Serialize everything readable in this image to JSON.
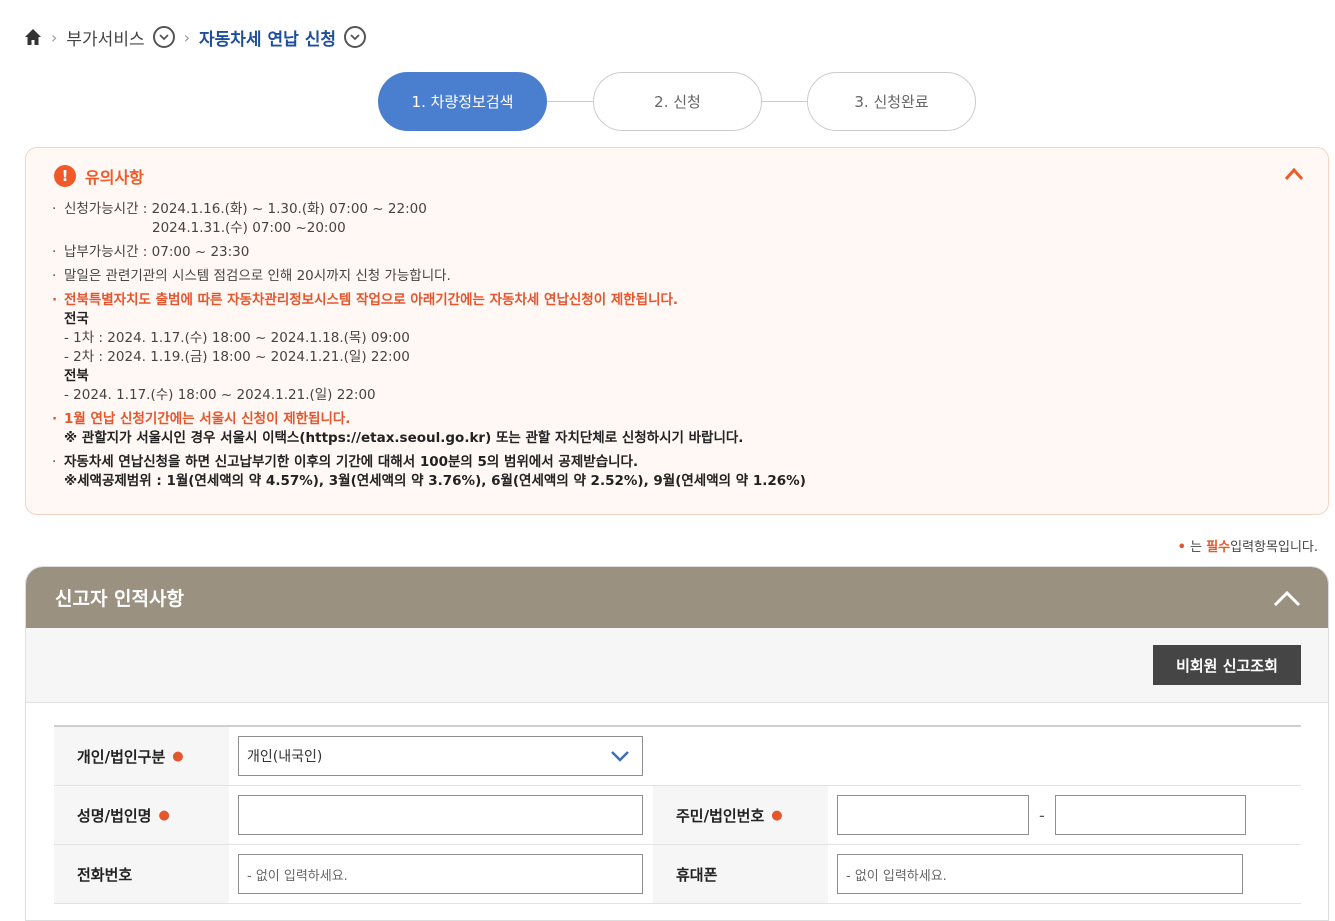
{
  "breadcrumb": {
    "home_icon": "home-icon",
    "item1": "부가서비스",
    "item2": "자동차세 연납 신청"
  },
  "steps": [
    {
      "label": "1. 차량정보검색",
      "active": true
    },
    {
      "label": "2. 신청",
      "active": false
    },
    {
      "label": "3. 신청완료",
      "active": false
    }
  ],
  "notice": {
    "title": "유의사항",
    "lines": {
      "l1": "신청가능시간 : 2024.1.16.(화) ~ 1.30.(화) 07:00 ~ 22:00",
      "l1b": "2024.1.31.(수) 07:00 ~20:00",
      "l2": "납부가능시간 : 07:00 ~ 23:30",
      "l3": "말일은 관련기관의 시스템 점검으로 인해 20시까지 신청 가능합니다.",
      "l4": "전북특별자치도 출범에 따른 자동차관리정보시스템 작업으로 아래기간에는 자동차세 연납신청이 제한됩니다.",
      "l4a": "전국",
      "l4b": "- 1차 : 2024. 1.17.(수) 18:00 ~ 2024.1.18.(목) 09:00",
      "l4c": "- 2차 : 2024. 1.19.(금) 18:00 ~ 2024.1.21.(일) 22:00",
      "l4d": "전북",
      "l4e": "- 2024. 1.17.(수) 18:00 ~ 2024.1.21.(일) 22:00",
      "l5": "1월 연납 신청기간에는 서울시 신청이 제한됩니다.",
      "l5b": "※ 관할지가 서울시인 경우 서울시 이택스(https://etax.seoul.go.kr) 또는 관할 자치단체로 신청하시기 바랍니다.",
      "l6": "자동차세 연납신청을 하면 신고납부기한 이후의 기간에 대해서 100분의 5의 범위에서 공제받습니다.",
      "l6b": "※세액공제범위 : 1월(연세액의 약 4.57%), 3월(연세액의 약 3.76%), 6월(연세액의 약 2.52%), 9월(연세액의 약 1.26%)"
    }
  },
  "required_note": {
    "dot": "•",
    "pre": "는",
    "required": "필수",
    "post": "입력항목입니다."
  },
  "panel": {
    "title": "신고자 인적사항",
    "lookup_button": "비회원 신고조회",
    "form": {
      "type_label": "개인/법인구분",
      "type_value": "개인(내국인)",
      "name_label": "성명/법인명",
      "name_value": "",
      "id_label": "주민/법인번호",
      "id_dash": "-",
      "phone_label": "전화번호",
      "phone_placeholder": "- 없이 입력하세요.",
      "mobile_label": "휴대폰",
      "mobile_placeholder": "- 없이 입력하세요."
    }
  }
}
